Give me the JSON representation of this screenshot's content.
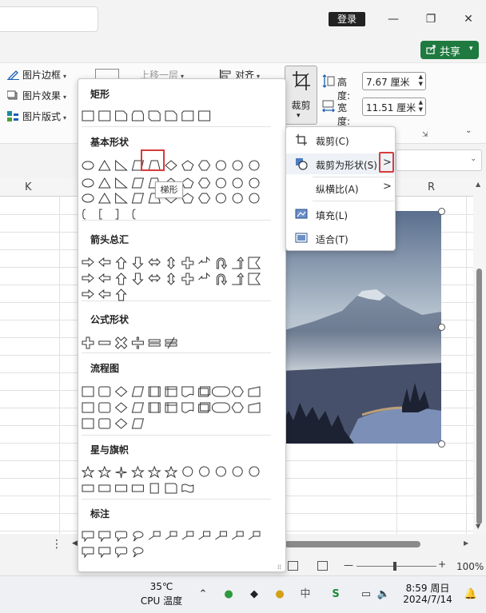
{
  "titlebar": {
    "login_label": "登录",
    "share_label": "共享"
  },
  "ribbon": {
    "picture_border": "图片边框",
    "picture_effects": "图片效果",
    "picture_layout": "图片版式",
    "bring_forward": "上移一层",
    "align": "对齐",
    "crop_label": "裁剪",
    "height_label": "高度:",
    "height_value": "7.67 厘米",
    "width_label": "宽度:",
    "width_value": "11.51 厘米"
  },
  "sheet": {
    "columns": [
      "K",
      "R"
    ]
  },
  "shapes_panel": {
    "sections": [
      {
        "title": "矩形"
      },
      {
        "title": "基本形状"
      },
      {
        "title": "箭头总汇"
      },
      {
        "title": "公式形状"
      },
      {
        "title": "流程图"
      },
      {
        "title": "星与旗帜"
      },
      {
        "title": "标注"
      }
    ],
    "tooltip": "梯形"
  },
  "crop_menu": {
    "items": [
      {
        "label": "裁剪(C)",
        "icon": "crop-icon"
      },
      {
        "label": "裁剪为形状(S)",
        "icon": "crop-to-shape-icon"
      },
      {
        "label": "纵横比(A)",
        "icon": "aspect-ratio"
      },
      {
        "label": "填充(L)",
        "icon": "fill-icon"
      },
      {
        "label": "适合(T)",
        "icon": "fit-icon"
      }
    ]
  },
  "statusbar": {
    "zoom": "100%"
  },
  "taskbar": {
    "temperature": "35℃",
    "cpu_label": "CPU 温度",
    "time": "8:59 周日",
    "date": "2024/7/14",
    "ime": "中"
  },
  "colors": {
    "accent_green": "#1f7a3f",
    "highlight_red": "#d63c3c"
  }
}
